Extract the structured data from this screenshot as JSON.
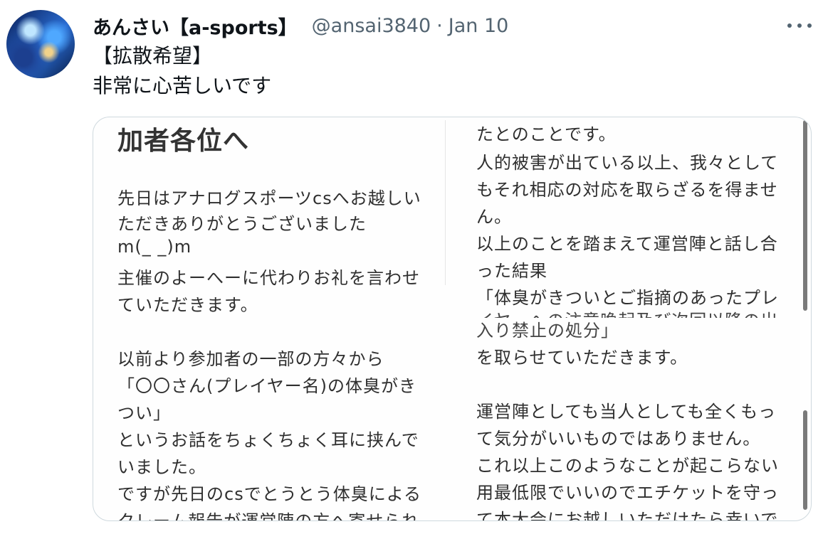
{
  "author": {
    "display_name": "あんさい【a-sports】",
    "handle": "@ansai3840",
    "separator": "·",
    "time": "Jan 10"
  },
  "more_icon": "more-horizontal-icon",
  "tweet": {
    "lines": [
      "【拡散希望】",
      "非常に心苦しいです"
    ]
  },
  "image": {
    "left_heading": "加者各位へ",
    "left_lines": [
      "先日はアナログスポーツcsへお越しい",
      "ただきありがとうございました",
      "m(_ _)m",
      "主催のよーへーに代わりお礼を言わせ",
      "ていただきます。",
      "以前より参加者の一部の方々から",
      "「〇〇さん(プレイヤー名)の体臭がき",
      "つい」",
      "というお話をちょくちょく耳に挟んで",
      "いました。",
      "ですが先日のcsでとうとう体臭による",
      "クレーム報告が運営陣の方へ寄せられ"
    ],
    "right_lines": [
      "たとのことです。",
      "人的被害が出ている以上、我々として",
      "もそれ相応の対応を取らざるを得ませ",
      "ん。",
      "以上のことを踏まえて運営陣と話し合",
      "った結果",
      "「体臭がきついとご指摘のあったプレ",
      "イヤーへの注意喚起及び次回以降の出",
      "入り禁止の処分」",
      "を取らせていただきます。",
      "運営陣としても当人としても全くもっ",
      "て気分がいいものではありません。",
      "これ以上このようなことが起こらない",
      "用最低限でいいのでエチケットを守っ",
      "て本大会にお越しいただけたら幸いで"
    ]
  }
}
